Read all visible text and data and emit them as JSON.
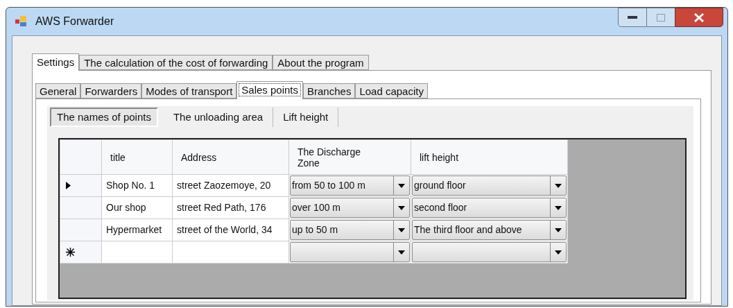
{
  "window": {
    "title": "AWS Forwarder"
  },
  "tabs": [
    {
      "label": "Settings",
      "selected": true
    },
    {
      "label": "The calculation of the cost of forwarding",
      "selected": false
    },
    {
      "label": "About the program",
      "selected": false
    }
  ],
  "settings_tabs": [
    {
      "label": "General",
      "selected": false
    },
    {
      "label": "Forwarders",
      "selected": false
    },
    {
      "label": "Modes of transport",
      "selected": false
    },
    {
      "label": "Sales points",
      "selected": true
    },
    {
      "label": "Branches",
      "selected": false
    },
    {
      "label": "Load capacity",
      "selected": false
    }
  ],
  "sales_tabs": [
    {
      "label": "The names of points",
      "selected": true
    },
    {
      "label": "The unloading area",
      "selected": false
    },
    {
      "label": "Lift height",
      "selected": false
    }
  ],
  "table": {
    "columns": [
      "title",
      "Address",
      "The Discharge Zone",
      "lift height"
    ],
    "rows": [
      {
        "kind": "data",
        "current": true,
        "cells": [
          "Shop No. 1",
          "street Zaozemoye, 20",
          "from 50 to 100 m",
          "ground floor"
        ]
      },
      {
        "kind": "data",
        "current": false,
        "cells": [
          "Our shop",
          "street Red Path, 176",
          "over 100 m",
          "second floor"
        ]
      },
      {
        "kind": "data",
        "current": false,
        "cells": [
          "Hypermarket",
          "street of the World, 34",
          "up to 50 m",
          "The third floor and above"
        ]
      },
      {
        "kind": "new",
        "current": false,
        "cells": []
      }
    ]
  }
}
